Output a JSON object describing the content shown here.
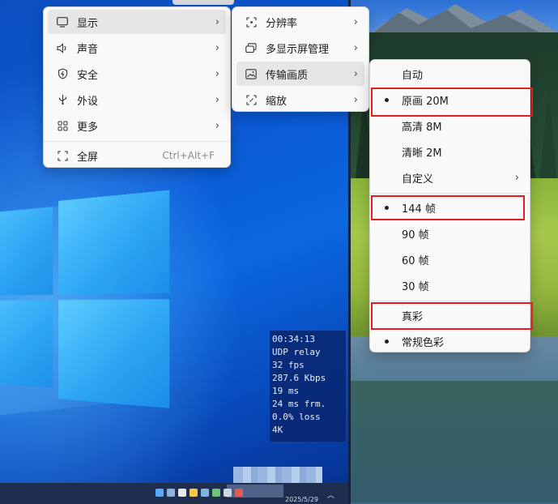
{
  "colors": {
    "accent_red": "#e02020",
    "menu_bg": "#f9f9f9",
    "highlight": "#e6e6e6"
  },
  "stats_overlay": {
    "lines": [
      "00:34:13",
      "UDP relay",
      "32 fps",
      "287.6 Kbps",
      "19 ms",
      "24 ms frm.",
      "0.0% loss",
      "4K"
    ]
  },
  "taskbar": {
    "date": "2025/5/29"
  },
  "main_menu": {
    "items": [
      {
        "label": "显示",
        "icon": "monitor-icon"
      },
      {
        "label": "声音",
        "icon": "speaker-icon"
      },
      {
        "label": "安全",
        "icon": "shield-icon"
      },
      {
        "label": "外设",
        "icon": "usb-icon"
      },
      {
        "label": "更多",
        "icon": "grid-icon"
      }
    ],
    "fullscreen": {
      "label": "全屏",
      "shortcut": "Ctrl+Alt+F",
      "icon": "fullscreen-icon"
    }
  },
  "display_menu": {
    "items": [
      {
        "label": "分辨率",
        "icon": "resolution-icon"
      },
      {
        "label": "多显示屏管理",
        "icon": "multi-monitor-icon"
      },
      {
        "label": "传输画质",
        "icon": "image-icon"
      },
      {
        "label": "缩放",
        "icon": "scale-icon"
      }
    ]
  },
  "quality_menu": {
    "quality": [
      "自动",
      "原画 20M",
      "高清 8M",
      "清晰 2M",
      "自定义"
    ],
    "selected_quality": "原画 20M",
    "framerate": [
      "144 帧",
      "90 帧",
      "60 帧",
      "30 帧"
    ],
    "selected_framerate": "144 帧",
    "color": [
      "真彩",
      "常规色彩"
    ],
    "selected_color": "常规色彩"
  }
}
